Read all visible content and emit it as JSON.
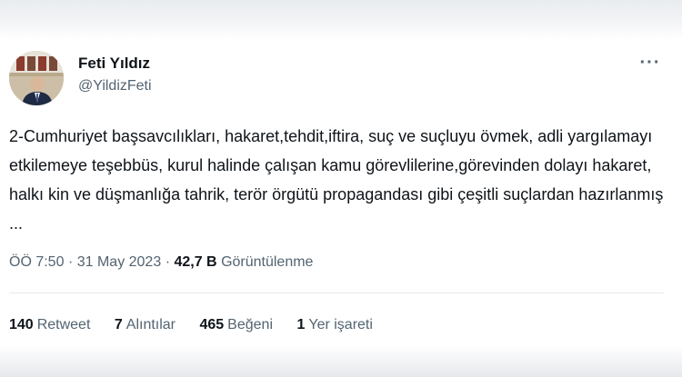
{
  "tweet": {
    "author": {
      "name": "Feti Yıldız",
      "handle": "@YildizFeti",
      "avatar_icon": "profile-photo"
    },
    "more_icon": "more-icon",
    "text": "2-Cumhuriyet başsavcılıkları, hakaret,tehdit,iftira, suç ve suçluyu övmek, adli yargılamayı etkilemeye teşebbüs, kurul halinde çalışan kamu görevlilerine,görevinden dolayı hakaret, halkı kin ve düşmanlığa tahrik, terör örgütü propagandası gibi çeşitli suçlardan hazırlanmış ...",
    "time": "ÖÖ 7:50",
    "separator": "·",
    "date": "31 May 2023",
    "views_count": "42,7 B",
    "views_label": "Görüntülenme"
  },
  "stats": {
    "retweets": {
      "count": "140",
      "label": "Retweet"
    },
    "quotes": {
      "count": "7",
      "label": "Alıntılar"
    },
    "likes": {
      "count": "465",
      "label": "Beğeni"
    },
    "bookmarks": {
      "count": "1",
      "label": "Yer işareti"
    }
  },
  "colors": {
    "text": "#0f1419",
    "secondary": "#536471",
    "divider": "#e6e9ec"
  }
}
